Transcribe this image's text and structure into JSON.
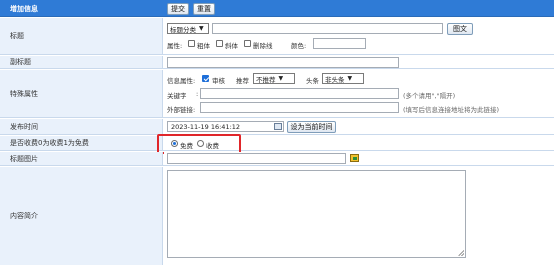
{
  "header": {
    "title": "增加信息",
    "submit_label": "提交",
    "reset_label": "重置"
  },
  "rows": {
    "title": {
      "label": "标题",
      "category_select": "标题分类",
      "image_button": "图文",
      "attr_label": "属性:",
      "bold_label": "粗体",
      "italic_label": "斜体",
      "strike_label": "删除线",
      "color_label": "颜色:"
    },
    "subtitle": {
      "label": "副标题"
    },
    "special": {
      "label": "特殊属性",
      "info_attr_label": "信息属性:",
      "review_label": "审核",
      "recommend_label": "推荐",
      "recommend_select": "不推荐",
      "headline_label": "头条",
      "headline_select": "非头条",
      "keyword_label": "关键字",
      "keyword_hint": "(多个请用\",\"隔开)",
      "external_label": "外部链接:",
      "external_hint": "(填写后信息连接地址将为此链接)"
    },
    "publish_time": {
      "label": "发布时间",
      "value": "2023-11-19 16:41:12",
      "set_now_label": "设为当前时间"
    },
    "charge": {
      "label": "是否收费0为收费1为免费",
      "free_label": "免费",
      "paid_label": "收费"
    },
    "title_image": {
      "label": "标题图片"
    },
    "summary": {
      "label": "内容简介"
    }
  },
  "colors": {
    "header_bg": "#2f7bd6",
    "label_bg": "#e9f1fb",
    "highlight_border": "#e0262a",
    "accent": "#1e6fd9"
  }
}
